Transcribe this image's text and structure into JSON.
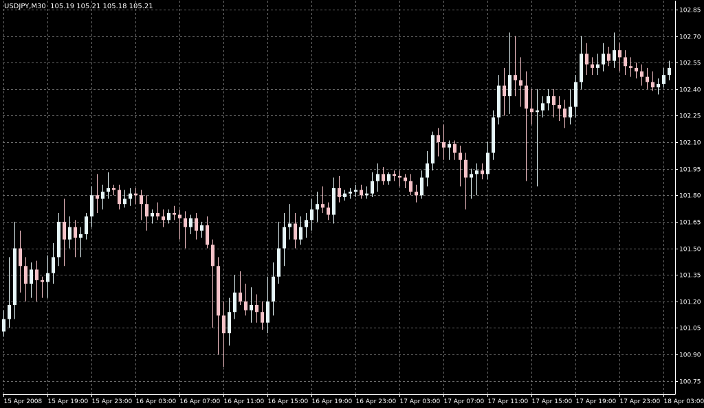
{
  "header": {
    "symbol": "USDJPY,M30",
    "ohlc": "105.19 105.21 105.18 105.21"
  },
  "colors": {
    "background": "#000000",
    "grid": "#6b6b6b",
    "axis": "#ffffff",
    "bull": "#e6f6f8",
    "bear": "#f5c2c8",
    "text": "#ffffff"
  },
  "chart_data": {
    "type": "candlestick",
    "title": "USDJPY,M30",
    "grid": true,
    "ylim": [
      100.675,
      102.9
    ],
    "y_ticks": [
      "102.85",
      "102.70",
      "102.55",
      "102.40",
      "102.25",
      "102.10",
      "101.95",
      "101.80",
      "101.65",
      "101.50",
      "101.35",
      "101.20",
      "101.05",
      "100.90",
      "100.75"
    ],
    "x_ticks": [
      "15 Apr 2008",
      "15 Apr 19:00",
      "15 Apr 23:00",
      "16 Apr 03:00",
      "16 Apr 07:00",
      "16 Apr 11:00",
      "16 Apr 15:00",
      "16 Apr 19:00",
      "16 Apr 23:00",
      "17 Apr 03:00",
      "17 Apr 07:00",
      "17 Apr 11:00",
      "17 Apr 15:00",
      "17 Apr 19:00",
      "17 Apr 23:00",
      "18 Apr 03:00"
    ],
    "x_tick_every": 8,
    "candles": [
      [
        101.03,
        101.15,
        101.0,
        101.1
      ],
      [
        101.1,
        101.45,
        101.05,
        101.18
      ],
      [
        101.18,
        101.65,
        101.1,
        101.5
      ],
      [
        101.5,
        101.6,
        101.25,
        101.4
      ],
      [
        101.4,
        101.45,
        101.2,
        101.3
      ],
      [
        101.3,
        101.42,
        101.22,
        101.38
      ],
      [
        101.38,
        101.43,
        101.2,
        101.32
      ],
      [
        101.32,
        101.34,
        101.22,
        101.31
      ],
      [
        101.31,
        101.46,
        101.22,
        101.36
      ],
      [
        101.36,
        101.53,
        101.3,
        101.45
      ],
      [
        101.45,
        101.7,
        101.4,
        101.65
      ],
      [
        101.65,
        101.78,
        101.4,
        101.55
      ],
      [
        101.55,
        101.68,
        101.5,
        101.62
      ],
      [
        101.62,
        101.66,
        101.45,
        101.56
      ],
      [
        101.56,
        101.62,
        101.45,
        101.58
      ],
      [
        101.58,
        101.7,
        101.55,
        101.68
      ],
      [
        101.68,
        101.85,
        101.62,
        101.8
      ],
      [
        101.8,
        101.92,
        101.7,
        101.78
      ],
      [
        101.78,
        101.86,
        101.72,
        101.82
      ],
      [
        101.82,
        101.93,
        101.78,
        101.84
      ],
      [
        101.84,
        101.86,
        101.8,
        101.83
      ],
      [
        101.83,
        101.86,
        101.72,
        101.75
      ],
      [
        101.75,
        101.83,
        101.73,
        101.78
      ],
      [
        101.78,
        101.84,
        101.74,
        101.81
      ],
      [
        101.81,
        101.84,
        101.75,
        101.8
      ],
      [
        101.8,
        101.83,
        101.66,
        101.75
      ],
      [
        101.75,
        101.8,
        101.6,
        101.68
      ],
      [
        101.68,
        101.72,
        101.64,
        101.7
      ],
      [
        101.7,
        101.76,
        101.66,
        101.68
      ],
      [
        101.68,
        101.72,
        101.62,
        101.66
      ],
      [
        101.66,
        101.72,
        101.64,
        101.7
      ],
      [
        101.7,
        101.74,
        101.66,
        101.69
      ],
      [
        101.69,
        101.72,
        101.55,
        101.67
      ],
      [
        101.67,
        101.71,
        101.5,
        101.62
      ],
      [
        101.62,
        101.69,
        101.58,
        101.67
      ],
      [
        101.67,
        101.7,
        101.55,
        101.6
      ],
      [
        101.6,
        101.65,
        101.56,
        101.63
      ],
      [
        101.63,
        101.68,
        101.5,
        101.52
      ],
      [
        101.52,
        101.55,
        101.05,
        101.4
      ],
      [
        101.4,
        101.45,
        100.9,
        101.12
      ],
      [
        101.12,
        101.2,
        100.83,
        101.02
      ],
      [
        101.02,
        101.22,
        100.95,
        101.14
      ],
      [
        101.14,
        101.35,
        101.1,
        101.25
      ],
      [
        101.25,
        101.37,
        101.18,
        101.2
      ],
      [
        101.2,
        101.3,
        101.12,
        101.15
      ],
      [
        101.15,
        101.28,
        101.08,
        101.18
      ],
      [
        101.18,
        101.24,
        101.08,
        101.14
      ],
      [
        101.14,
        101.2,
        101.04,
        101.08
      ],
      [
        101.08,
        101.34,
        101.02,
        101.2
      ],
      [
        101.2,
        101.42,
        101.12,
        101.34
      ],
      [
        101.34,
        101.65,
        101.3,
        101.5
      ],
      [
        101.5,
        101.7,
        101.4,
        101.62
      ],
      [
        101.62,
        101.75,
        101.55,
        101.64
      ],
      [
        101.64,
        101.7,
        101.5,
        101.55
      ],
      [
        101.55,
        101.68,
        101.52,
        101.62
      ],
      [
        101.62,
        101.7,
        101.56,
        101.66
      ],
      [
        101.66,
        101.78,
        101.6,
        101.72
      ],
      [
        101.72,
        101.82,
        101.65,
        101.75
      ],
      [
        101.75,
        101.85,
        101.7,
        101.73
      ],
      [
        101.73,
        101.76,
        101.66,
        101.69
      ],
      [
        101.69,
        101.9,
        101.64,
        101.84
      ],
      [
        101.84,
        101.91,
        101.76,
        101.79
      ],
      [
        101.79,
        101.83,
        101.77,
        101.81
      ],
      [
        101.81,
        101.84,
        101.78,
        101.82
      ],
      [
        101.82,
        101.86,
        101.79,
        101.83
      ],
      [
        101.83,
        101.86,
        101.78,
        101.8
      ],
      [
        101.8,
        101.85,
        101.78,
        101.81
      ],
      [
        101.81,
        101.93,
        101.79,
        101.88
      ],
      [
        101.88,
        101.98,
        101.82,
        101.92
      ],
      [
        101.92,
        101.96,
        101.86,
        101.88
      ],
      [
        101.88,
        101.93,
        101.86,
        101.92
      ],
      [
        101.92,
        101.94,
        101.88,
        101.91
      ],
      [
        101.91,
        101.94,
        101.85,
        101.9
      ],
      [
        101.9,
        101.92,
        101.84,
        101.88
      ],
      [
        101.88,
        101.92,
        101.8,
        101.82
      ],
      [
        101.82,
        101.86,
        101.76,
        101.8
      ],
      [
        101.8,
        101.94,
        101.78,
        101.9
      ],
      [
        101.9,
        102.05,
        101.85,
        101.98
      ],
      [
        101.98,
        102.16,
        101.94,
        102.14
      ],
      [
        102.14,
        102.18,
        102.02,
        102.1
      ],
      [
        102.1,
        102.2,
        102.0,
        102.07
      ],
      [
        102.07,
        102.11,
        102.0,
        102.09
      ],
      [
        102.09,
        102.11,
        102.0,
        102.04
      ],
      [
        102.04,
        102.08,
        101.85,
        102.0
      ],
      [
        102.0,
        102.04,
        101.72,
        101.9
      ],
      [
        101.9,
        101.95,
        101.78,
        101.92
      ],
      [
        101.92,
        101.98,
        101.8,
        101.94
      ],
      [
        101.94,
        101.98,
        101.89,
        101.92
      ],
      [
        101.92,
        102.1,
        101.89,
        102.04
      ],
      [
        102.04,
        102.28,
        102.0,
        102.24
      ],
      [
        102.24,
        102.48,
        102.2,
        102.42
      ],
      [
        102.42,
        102.52,
        102.25,
        102.36
      ],
      [
        102.36,
        102.72,
        102.26,
        102.48
      ],
      [
        102.48,
        102.7,
        102.36,
        102.45
      ],
      [
        102.45,
        102.58,
        102.3,
        102.42
      ],
      [
        102.42,
        102.5,
        101.88,
        102.29
      ],
      [
        102.29,
        102.4,
        102.2,
        102.27
      ],
      [
        102.27,
        102.4,
        101.85,
        102.28
      ],
      [
        102.28,
        102.36,
        102.24,
        102.32
      ],
      [
        102.32,
        102.4,
        102.28,
        102.36
      ],
      [
        102.36,
        102.4,
        102.24,
        102.31
      ],
      [
        102.31,
        102.36,
        102.22,
        102.29
      ],
      [
        102.29,
        102.34,
        102.18,
        102.24
      ],
      [
        102.24,
        102.4,
        102.2,
        102.3
      ],
      [
        102.3,
        102.48,
        102.24,
        102.44
      ],
      [
        102.44,
        102.7,
        102.4,
        102.6
      ],
      [
        102.6,
        102.66,
        102.48,
        102.54
      ],
      [
        102.54,
        102.58,
        102.48,
        102.52
      ],
      [
        102.52,
        102.6,
        102.48,
        102.54
      ],
      [
        102.54,
        102.66,
        102.5,
        102.6
      ],
      [
        102.6,
        102.64,
        102.53,
        102.56
      ],
      [
        102.56,
        102.72,
        102.52,
        102.62
      ],
      [
        102.62,
        102.66,
        102.5,
        102.58
      ],
      [
        102.58,
        102.62,
        102.48,
        102.53
      ],
      [
        102.53,
        102.58,
        102.47,
        102.52
      ],
      [
        102.52,
        102.55,
        102.46,
        102.5
      ],
      [
        102.5,
        102.54,
        102.42,
        102.47
      ],
      [
        102.47,
        102.52,
        102.4,
        102.44
      ],
      [
        102.44,
        102.5,
        102.39,
        102.41
      ],
      [
        102.41,
        102.46,
        102.37,
        102.43
      ],
      [
        102.43,
        102.52,
        102.41,
        102.48
      ],
      [
        102.48,
        102.56,
        102.45,
        102.52
      ],
      [
        102.52,
        102.56,
        102.47,
        102.49
      ]
    ]
  }
}
